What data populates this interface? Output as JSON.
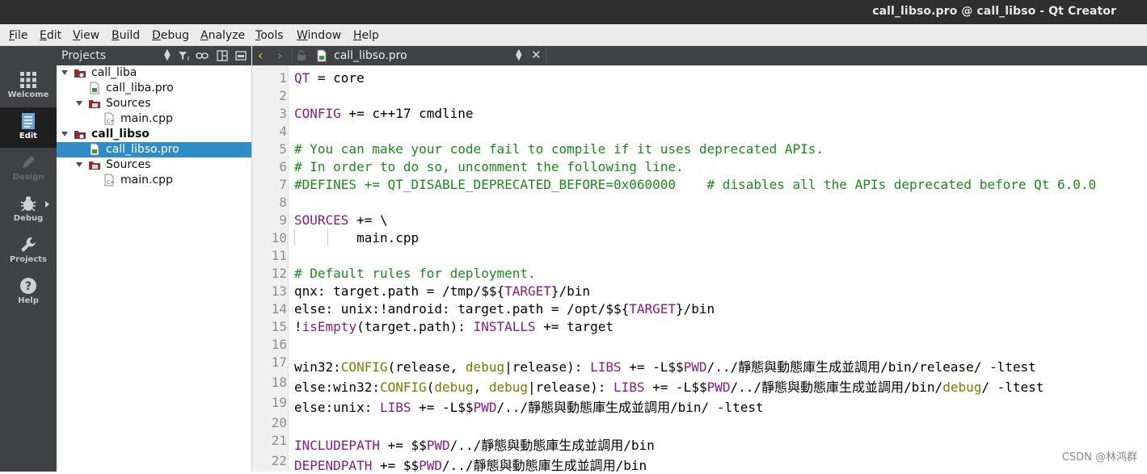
{
  "window": {
    "title": "call_libso.pro @ call_libso - Qt Creator"
  },
  "menubar": {
    "items": [
      {
        "label": "File",
        "u": "F",
        "rest": "ile"
      },
      {
        "label": "Edit",
        "u": "E",
        "rest": "dit"
      },
      {
        "label": "View",
        "u": "V",
        "rest": "iew"
      },
      {
        "label": "Build",
        "u": "B",
        "rest": "uild"
      },
      {
        "label": "Debug",
        "u": "D",
        "rest": "ebug"
      },
      {
        "label": "Analyze",
        "u": "A",
        "rest": "nalyze"
      },
      {
        "label": "Tools",
        "u": "T",
        "rest": "ools"
      },
      {
        "label": "Window",
        "u": "W",
        "rest": "indow"
      },
      {
        "label": "Help",
        "u": "H",
        "rest": "elp"
      }
    ]
  },
  "modebar": {
    "modes": [
      {
        "label": "Welcome",
        "icon": "grid-icon",
        "state": "normal"
      },
      {
        "label": "Edit",
        "icon": "document-icon",
        "state": "active"
      },
      {
        "label": "Design",
        "icon": "pen-icon",
        "state": "disabled"
      },
      {
        "label": "Debug",
        "icon": "bug-icon",
        "state": "normal"
      },
      {
        "label": "Projects",
        "icon": "wrench-icon",
        "state": "normal"
      },
      {
        "label": "Help",
        "icon": "help-icon",
        "state": "normal"
      }
    ]
  },
  "projects_panel": {
    "title": "Projects",
    "tree": [
      {
        "label": "call_liba",
        "type": "project",
        "bold": false,
        "selected": false
      },
      {
        "label": "call_liba.pro",
        "type": "pro-file",
        "bold": false,
        "selected": false
      },
      {
        "label": "Sources",
        "type": "folder",
        "bold": false,
        "selected": false
      },
      {
        "label": "main.cpp",
        "type": "cpp-file",
        "bold": false,
        "selected": false
      },
      {
        "label": "call_libso",
        "type": "project",
        "bold": true,
        "selected": false
      },
      {
        "label": "call_libso.pro",
        "type": "pro-file",
        "bold": false,
        "selected": true
      },
      {
        "label": "Sources",
        "type": "folder",
        "bold": false,
        "selected": false
      },
      {
        "label": "main.cpp",
        "type": "cpp-file",
        "bold": false,
        "selected": false
      }
    ]
  },
  "editor": {
    "file_name": "call_libso.pro",
    "line_numbers": [
      "1",
      "2",
      "3",
      "4",
      "5",
      "6",
      "7",
      "8",
      "9",
      "10",
      "11",
      "12",
      "13",
      "14",
      "15",
      "16",
      "17",
      "18",
      "19",
      "20",
      "21",
      "22"
    ]
  },
  "watermark": "CSDN @林鸿群",
  "colors": {
    "keyword": "#8a1a8a",
    "comment": "#1a8a1a",
    "selection": "#308cc6",
    "sidebar": "#404244"
  }
}
